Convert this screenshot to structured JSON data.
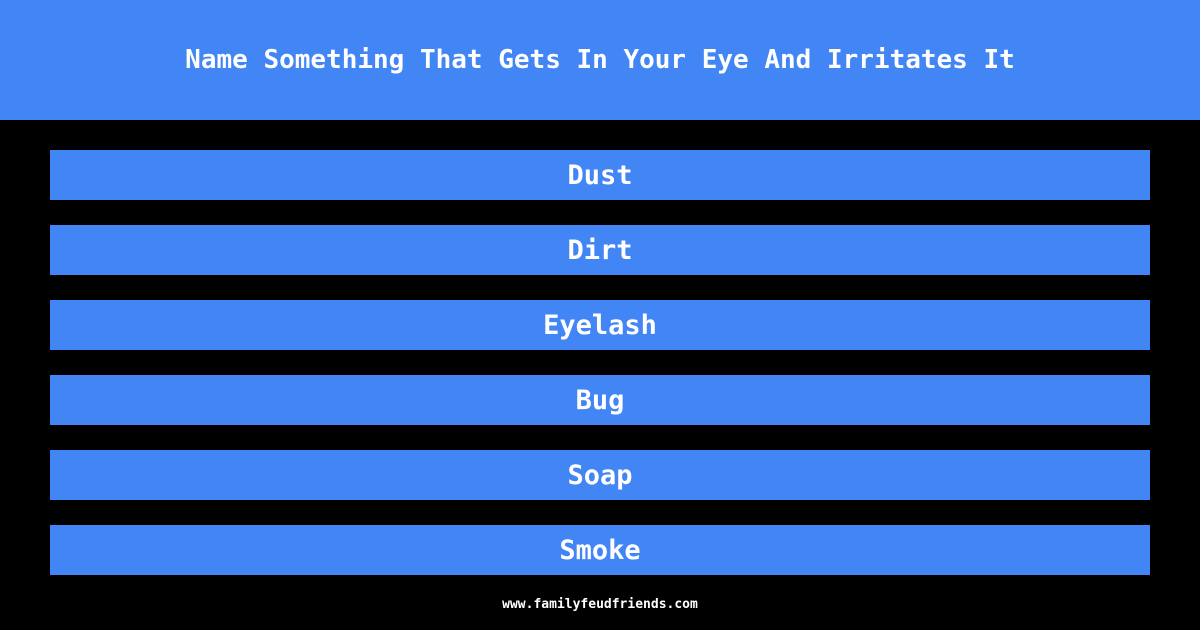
{
  "question": "Name Something That Gets In Your Eye And Irritates It",
  "answers": [
    "Dust",
    "Dirt",
    "Eyelash",
    "Bug",
    "Soap",
    "Smoke"
  ],
  "footer": "www.familyfeudfriends.com",
  "colors": {
    "accent": "#4285f4",
    "background": "#000000",
    "text": "#ffffff"
  }
}
